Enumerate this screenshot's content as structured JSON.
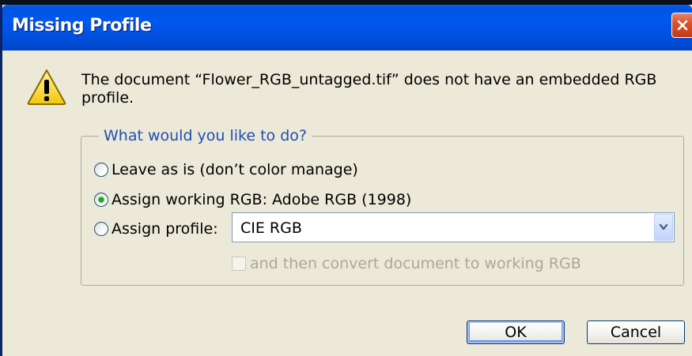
{
  "dialog": {
    "title": "Missing Profile",
    "message": "The document “Flower_RGB_untagged.tif” does not have an embedded RGB profile.",
    "group_label": "What would you like to do?",
    "options": [
      {
        "label": "Leave as is (don’t color manage)",
        "selected": false
      },
      {
        "label": "Assign working RGB:  Adobe RGB (1998)",
        "selected": true
      },
      {
        "label": "Assign profile:",
        "selected": false
      }
    ],
    "profile_select": {
      "value": "CIE RGB"
    },
    "convert_checkbox": {
      "label": "and then convert document to working RGB",
      "checked": false,
      "enabled": false
    },
    "ok_label": "OK",
    "cancel_label": "Cancel"
  },
  "icons": {
    "title_close": "close-icon",
    "warning": "warning-icon",
    "dropdown": "chevron-down-icon"
  },
  "colors": {
    "titlebar": "#0054E3",
    "dialog_bg": "#ECE9D8",
    "group_label": "#1F4EB4",
    "close_button": "#D8542E"
  }
}
